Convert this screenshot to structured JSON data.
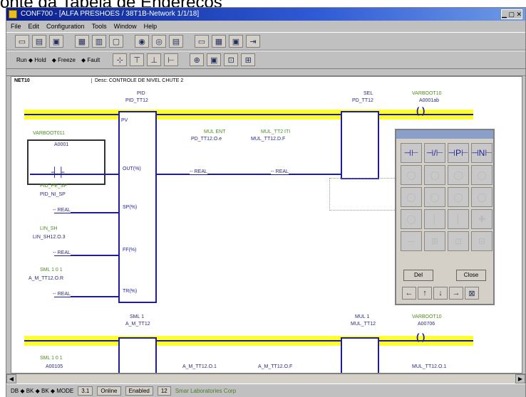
{
  "doc_heading": "onte da Tabela de Endereços",
  "window": {
    "title": "CONF700 - [ALFA PRESHOES / 38T1B-Network 1/1/18]",
    "menu": [
      "File",
      "Edit",
      "Configuration",
      "Tools",
      "Window",
      "Help"
    ],
    "toolbar2_text": [
      "Run ◆ Hold",
      "◆ Freeze",
      "◆ Fault"
    ]
  },
  "editor": {
    "network_id": "NET10",
    "description": "Desc: CONTROLE DE NIVEL CHUTE 2",
    "labels": {
      "blk1_type": "PID",
      "blk1_name": "PID_TT12",
      "blk2_type": "SEL",
      "blk2_name": "PD_TT12",
      "mid_a1": "MUL ENT",
      "mid_a2": "PD_TT12.O.e",
      "mid_b1": "MUL_TT2 ITI",
      "mid_b2": "MUL_TT12.D.F",
      "coil_top_name": "VARBOOT10",
      "coil_top_addr": "A0001ab",
      "contact_name": "VARBOOT011",
      "contact_addr": "A0001",
      "in1_name": "PID_NI_SP",
      "in1_sub": "PID_PE_SP",
      "in2_name": "LIN_SH12.O.3",
      "in2_sub": "LIN_SH",
      "in3_name": "A_M_TT12.O.R",
      "in3_sub": "SML 1 0 1",
      "real_tag": "-- REAL",
      "pin_pvin": "PV",
      "pin_out": "OUT(%)",
      "pin_sp": "SP(%)",
      "pin_ff": "FF(%)",
      "pin_tr": "TR(%)",
      "bot_sel": "SML 1",
      "bot_sel_name": "A_M_TT12",
      "bot_mul": "MUL 1",
      "bot_mul_name": "MUL_TT12",
      "bot_coil_name": "VARBOOT10",
      "bot_coil_addr": "A00706",
      "bot_in_a": "A_M_TT12.O.1",
      "bot_in_b": "A_M_TT12.O.F",
      "bot_in_c": "MUL_TT12.O.1",
      "bot_left": "A00105"
    }
  },
  "palette": {
    "row1": [
      "⊣⊢",
      "⊣/⊢",
      "⊣P⊢",
      "⊣N⊢"
    ],
    "row2": [
      "◯",
      "◯",
      "◯",
      "◯"
    ],
    "row3": [
      "◯",
      "◯",
      "◯",
      "◯"
    ],
    "row4": [
      "◯",
      "│",
      "│",
      "✚"
    ],
    "row5": [
      "─",
      "⊞",
      "⊡",
      "⊟"
    ],
    "btn_left": "Del",
    "btn_right": "Close",
    "nav": [
      "←",
      "↑",
      "↓",
      "→",
      "⊠"
    ]
  },
  "status": {
    "left": "DB ◆ BK ◆ BK ◆ MODE",
    "mid1": "3.1",
    "mid2": "Online",
    "mid3": "Enabled",
    "mid4": "12",
    "tail": "Smar Laboratories Corp"
  }
}
